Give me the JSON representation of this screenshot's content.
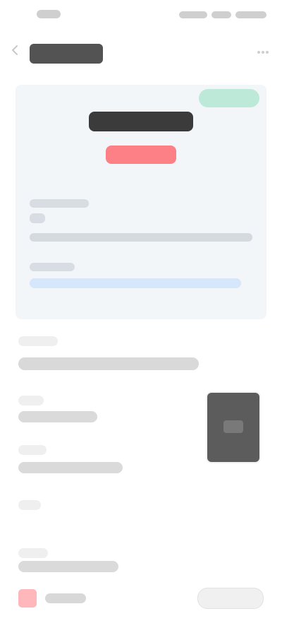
{
  "status_bar": {
    "time": "",
    "battery": ""
  },
  "header": {
    "title": "",
    "back_icon": "back-arrow-icon",
    "more_icon": "more-icon"
  },
  "card": {
    "tag": "",
    "main_value": "",
    "amount": "",
    "info1_label": "",
    "info1_sub": "",
    "info1_line": "",
    "info2_label": "",
    "info2_link": ""
  },
  "section": {
    "label": "",
    "desc": ""
  },
  "blocks": {
    "a_label": "",
    "a_value": "",
    "b_label": "",
    "b_value": "",
    "c_label": "",
    "d_label": "",
    "d_value": ""
  },
  "bottom": {
    "left_label": "",
    "right_button": ""
  },
  "colors": {
    "tag_bg": "#bde9d9",
    "amount_bg": "#ff6b73",
    "link_bg": "#d6e6fb",
    "bottom_icon": "#ffb3b8"
  }
}
